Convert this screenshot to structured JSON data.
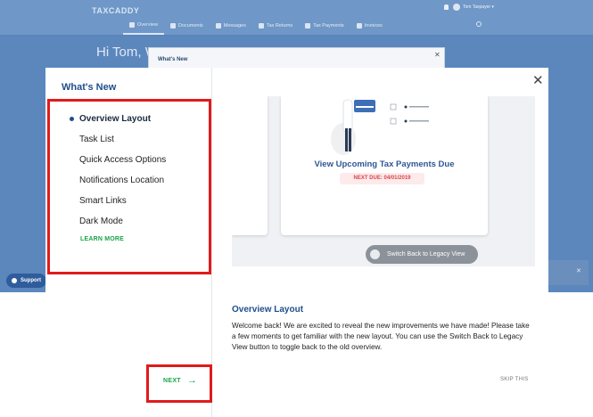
{
  "background_app": {
    "logo": "TAXCADDY",
    "nav_tabs": [
      "Overview",
      "Documents",
      "Messages",
      "Tax Returns",
      "Tax Payments",
      "Invoices"
    ],
    "user_name": "Tom Taxpayer",
    "greeting": "Hi Tom, W",
    "mini_modal_title": "What's New",
    "support_label": "Support"
  },
  "modal": {
    "title": "What's New",
    "nav_items": [
      {
        "label": "Overview Layout",
        "active": true
      },
      {
        "label": "Task List",
        "active": false
      },
      {
        "label": "Quick Access Options",
        "active": false
      },
      {
        "label": "Notifications Location",
        "active": false
      },
      {
        "label": "Smart Links",
        "active": false
      },
      {
        "label": "Dark Mode",
        "active": false
      }
    ],
    "learn_more": "LEARN MORE",
    "next_label": "NEXT",
    "skip_label": "SKIP THIS",
    "close_symbol": "✕",
    "preview": {
      "headline": "View Upcoming Tax Payments Due",
      "next_due": "NEXT DUE: 04/01/2019",
      "switch_button": "Switch Back to Legacy View"
    },
    "content": {
      "title": "Overview Layout",
      "body": "Welcome back! We are excited to reveal the new improvements we have made! Please take a few moments to get familiar with the new layout. You can use the Switch Back to Legacy View button to toggle back to the old overview."
    }
  },
  "colors": {
    "accent_blue": "#1f4e8c",
    "accent_green": "#1aa34a",
    "highlight_red": "#e01b1b",
    "due_red": "#d8454a"
  }
}
